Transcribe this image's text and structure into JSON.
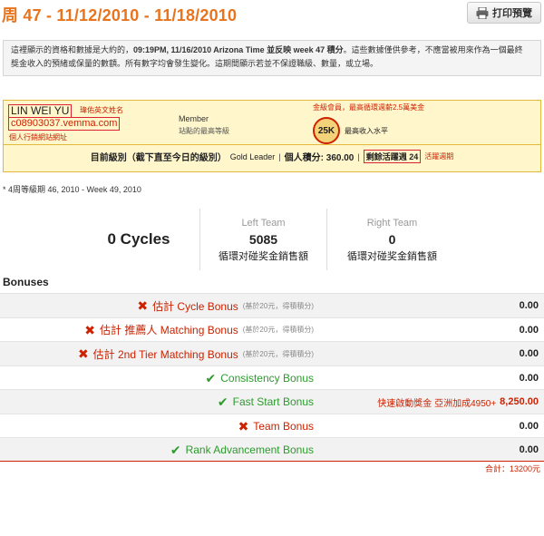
{
  "header": {
    "title": "周 47 - 11/12/2010 - 11/18/2010",
    "print_label": "打印預覽"
  },
  "notice": {
    "line1_pre": "這裡顯示的資格和數據是大約的，",
    "line1_time": "09:19PM, 11/16/2010 Arizona Time 並反映 week 47 積分",
    "line1_post": "。這些數據僅供參考，不應當被用來作為一個最終",
    "line2": "獎金收入的預緒或保量的數額。所有數字均會發生變化。這期間顯示若並不保證職級、數量，或立場。"
  },
  "member": {
    "name": "LIN WEI YU",
    "name_note": "瑋佑英文姓名",
    "url": "c08903037.vemma.com",
    "url_note": "個人行銷網站網址",
    "level": "Member",
    "level_sub": "站點的最高等級",
    "gold_note": "金級會員，最高循環週薪2.5萬美金",
    "badge": "25K",
    "badge_note": "最高收入水平",
    "status_label": "目前級別（截下直至今日的級別）",
    "rank": "Gold Leader",
    "points": "個人積分: 360.00",
    "weeks_left": "剩餘活躍週 24",
    "weeks_note": "活躍週期"
  },
  "week_range": "* 4周等級期 46, 2010 - Week 49, 2010",
  "stats": {
    "cycles": "0 Cycles",
    "left_label": "Left Team",
    "left_value": "5085",
    "left_sub": "循環对碰奖金銷售額",
    "right_label": "Right Team",
    "right_value": "0",
    "right_sub": "循環对碰奖金銷售額"
  },
  "bonuses_title": "Bonuses",
  "bonuses": [
    {
      "status": "✖",
      "label": "估計 Cycle Bonus",
      "sub": "(基於20元，得積積分)",
      "amount": "0.00",
      "color": "red"
    },
    {
      "status": "✖",
      "label": "估計 推薦人 Matching Bonus",
      "sub": "(基於20元，得積積分)",
      "amount": "0.00",
      "color": "red"
    },
    {
      "status": "✖",
      "label": "估計 2nd Tier Matching Bonus",
      "sub": "(基於20元，得積積分)",
      "amount": "0.00",
      "color": "red"
    },
    {
      "status": "✔",
      "label": "Consistency Bonus",
      "sub": "",
      "amount": "0.00",
      "color": "green"
    },
    {
      "status": "✔",
      "label": "Fast Start Bonus",
      "sub": "",
      "promo": "快速啟動獎金 亞洲加成4950+",
      "amount": "8,250.00",
      "color": "green"
    },
    {
      "status": "✖",
      "label": "Team Bonus",
      "sub": "",
      "amount": "0.00",
      "color": "red"
    },
    {
      "status": "✔",
      "label": "Rank Advancement Bonus",
      "sub": "",
      "amount": "0.00",
      "color": "green"
    }
  ],
  "total": "合計：13200元",
  "colors": {
    "accent": "#e8741e",
    "alert": "#cc2200",
    "success": "#2e9a2e",
    "highlight_bg": "#fff6cc"
  }
}
